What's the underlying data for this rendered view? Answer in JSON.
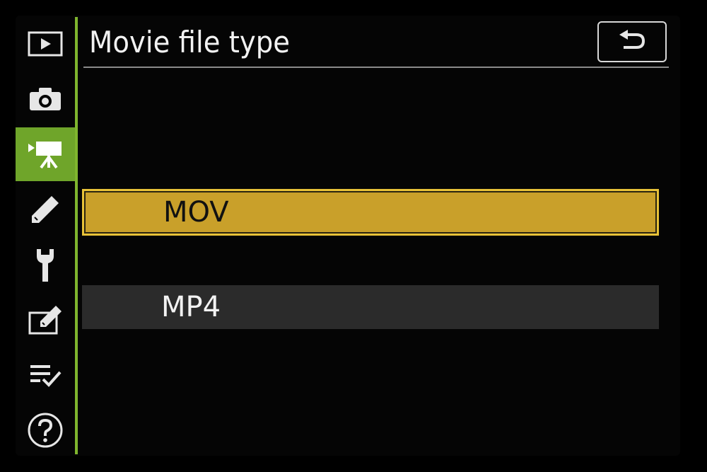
{
  "header": {
    "title": "Movie file type"
  },
  "sidebar": {
    "items": [
      {
        "icon": "playback-icon"
      },
      {
        "icon": "camera-icon"
      },
      {
        "icon": "movie-camera-icon",
        "active": true
      },
      {
        "icon": "pencil-icon"
      },
      {
        "icon": "wrench-icon"
      },
      {
        "icon": "retouch-icon"
      },
      {
        "icon": "my-menu-icon"
      },
      {
        "icon": "help-icon"
      }
    ]
  },
  "options": [
    {
      "label": "MOV",
      "selected": true
    },
    {
      "label": "MP4",
      "selected": false
    }
  ],
  "colors": {
    "accent_green": "#6fa52a",
    "highlight_yellow": "#c9a02a",
    "row_gray": "#2b2b2b",
    "background": "#000000"
  }
}
